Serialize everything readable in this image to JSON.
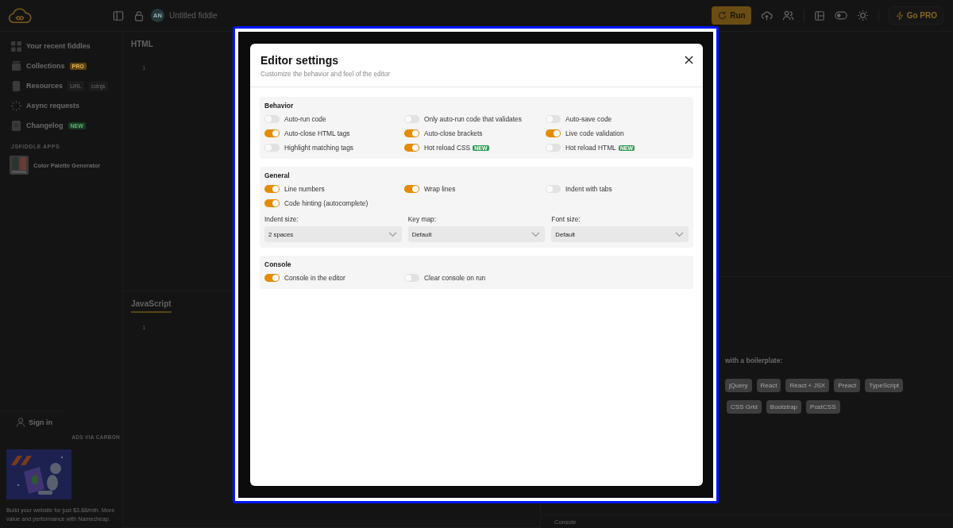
{
  "topbar": {
    "avatar_initials": "AN",
    "title": "Untitled fiddle",
    "run_button": "Run",
    "go_pro_button": "Go PRO"
  },
  "sidebar": {
    "items": [
      {
        "kind": "grid",
        "label": "Your recent fiddles"
      },
      {
        "kind": "box",
        "label": "Collections",
        "badge": "PRO"
      },
      {
        "kind": "file",
        "label": "Resources",
        "tags": [
          "URL",
          "cdnjs"
        ]
      },
      {
        "kind": "spinner",
        "label": "Async requests"
      },
      {
        "kind": "doc",
        "label": "Changelog",
        "badge": "NEW"
      }
    ],
    "apps_heading": "JSFIDDLE APPS",
    "apps": [
      {
        "label": "Color Palette Generator"
      }
    ],
    "sign_in": "Sign in",
    "ad": {
      "label": "ADS VIA CARBON",
      "text": "Build your website for just $3.88/mth. More value and performance with Namecheap."
    }
  },
  "editors": [
    {
      "title": "HTML",
      "line": "1",
      "active": false
    },
    {
      "title": "JavaScript",
      "line": "1",
      "active": true
    }
  ],
  "result": {
    "heading": "with a boilerplate:",
    "chips": [
      [
        "jQuery",
        "React",
        "React + JSX",
        "Preact",
        "TypeScript"
      ],
      [
        "CSS Grid",
        "Bootstrap",
        "PostCSS"
      ]
    ]
  },
  "console_bar": {
    "label": "Console"
  },
  "modal": {
    "title": "Editor settings",
    "subtitle": "Customize the behavior and feel of the editor",
    "sections": [
      {
        "title": "Behavior",
        "toggles": [
          {
            "label": "Auto-run code",
            "on": false
          },
          {
            "label": "Only auto-run code that validates",
            "on": false
          },
          {
            "label": "Auto-save code",
            "on": false
          },
          {
            "label": "Auto-close HTML tags",
            "on": true
          },
          {
            "label": "Auto-close brackets",
            "on": true
          },
          {
            "label": "Live code validation",
            "on": true
          },
          {
            "label": "Highlight matching tags",
            "on": false
          },
          {
            "label": "Hot reload CSS",
            "on": true,
            "badge": "NEW"
          },
          {
            "label": "Hot reload HTML",
            "on": false,
            "badge": "NEW"
          }
        ]
      },
      {
        "title": "General",
        "toggles": [
          {
            "label": "Line numbers",
            "on": true
          },
          {
            "label": "Wrap lines",
            "on": true
          },
          {
            "label": "Indent with tabs",
            "on": false
          },
          {
            "label": "Code hinting (autocomplete)",
            "on": true
          }
        ],
        "selects": [
          {
            "label": "Indent size:",
            "value": "2 spaces"
          },
          {
            "label": "Key map:",
            "value": "Default"
          },
          {
            "label": "Font size:",
            "value": "Default"
          }
        ]
      },
      {
        "title": "Console",
        "toggles": [
          {
            "label": "Console in the editor",
            "on": true
          },
          {
            "label": "Clear console on run",
            "on": false
          }
        ]
      }
    ]
  }
}
